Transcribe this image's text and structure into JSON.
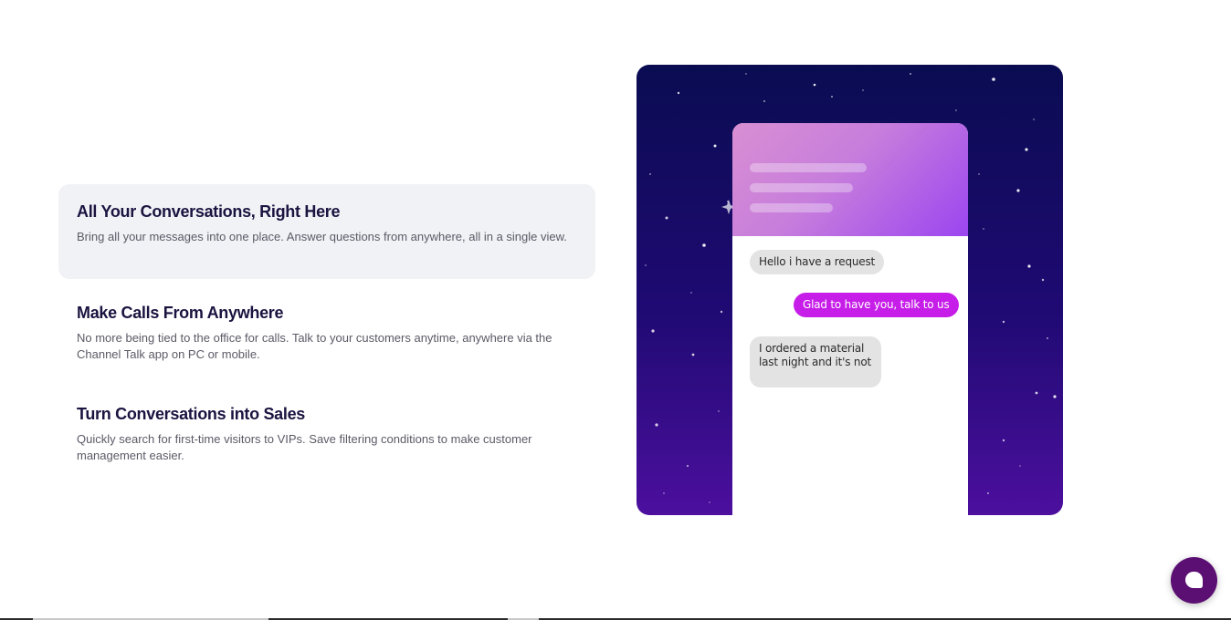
{
  "features": [
    {
      "title": "All Your Conversations, Right Here",
      "description": "Bring all your messages into one place. Answer questions from anywhere, all in a single view."
    },
    {
      "title": "Make Calls From Anywhere",
      "description": "No more being tied to the office for calls. Talk to your customers anytime, anywhere via the Channel Talk app on PC or mobile."
    },
    {
      "title": "Turn Conversations into Sales",
      "description": "Quickly search for first-time visitors to VIPs. Save filtering conditions to make customer management easier."
    }
  ],
  "active_feature": 0,
  "phone_chat": {
    "messages": [
      {
        "from": "customer",
        "text": "Hello i have a request"
      },
      {
        "from": "agent",
        "text": "Glad to have you, talk to us"
      },
      {
        "from": "customer",
        "text": "I ordered a material last night and it's not"
      }
    ]
  },
  "chat_launcher": {
    "icon": "chat-bubble-icon"
  },
  "colors": {
    "title": "#1b1340",
    "description": "#5b5a66",
    "active_card": "#f1f2f6",
    "agent_bubble": "#c61ee8",
    "customer_bubble": "#e3e3e3",
    "launcher": "#5c0f73"
  }
}
